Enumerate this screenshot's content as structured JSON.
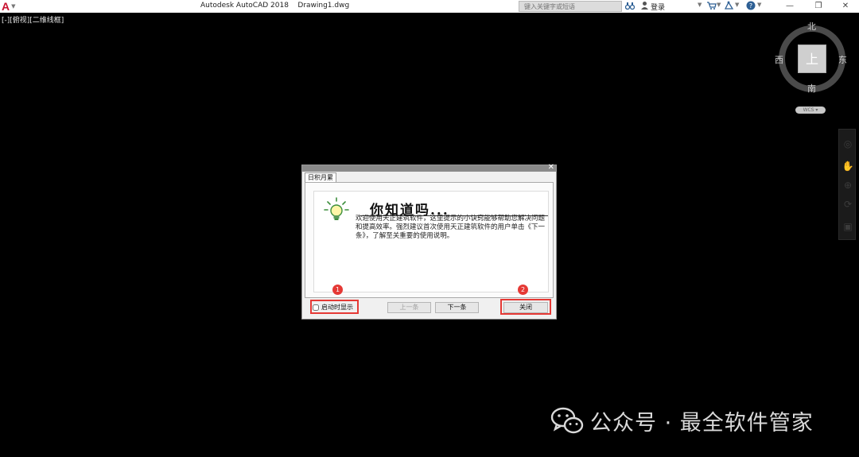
{
  "titlebar": {
    "app_letter": "A",
    "title": "Autodesk AutoCAD 2018    Drawing1.dwg",
    "search_placeholder": "键入关键字或短语",
    "signin_label": "登录"
  },
  "viewport": {
    "label": "[-][俯视][二维线框]"
  },
  "viewcube": {
    "face": "上",
    "north": "北",
    "south": "南",
    "west": "西",
    "east": "东",
    "wcs_label": "WCS ▾"
  },
  "dialog": {
    "tab_label": "日积月累",
    "heading": "你知道吗...",
    "body": "欢迎使用天正建筑软件，这里提示的小诀窍能够帮助您解决问题和提高效率。强烈建议首次使用天正建筑软件的用户单击《下一条》，了解至关重要的使用说明。",
    "startup_checkbox_label": "启动时显示",
    "startup_checked": false,
    "prev_label": "上一条",
    "next_label": "下一条",
    "close_label": "关闭"
  },
  "annotations": {
    "badge_1": "1",
    "badge_2": "2",
    "color": "#e53935"
  },
  "watermark": {
    "text": "公众号 · 最全软件管家"
  }
}
